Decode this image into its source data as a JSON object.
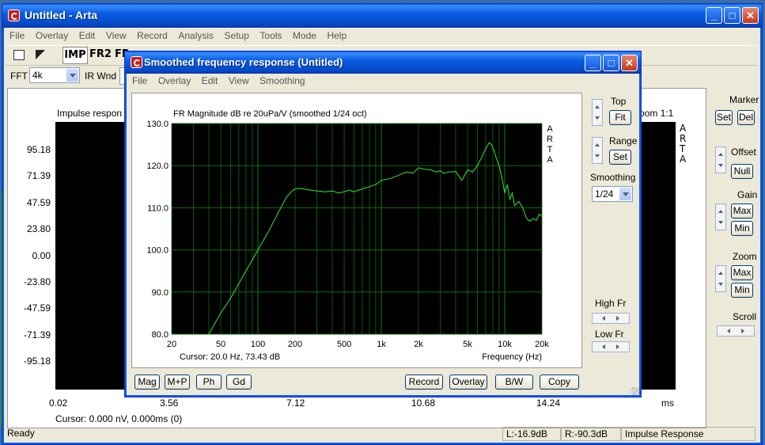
{
  "main": {
    "title": "Untitled - Arta",
    "menu": [
      "File",
      "Overlay",
      "Edit",
      "View",
      "Record",
      "Analysis",
      "Setup",
      "Tools",
      "Mode",
      "Help"
    ],
    "toolbar": {
      "imp": "IMP",
      "fr2": "FR2",
      "fr": "FR"
    },
    "fft_label": "FFT",
    "fft_value": "4k",
    "irwnd_label": "IR Wnd",
    "plot_title_left": "Impulse respon",
    "plot_title_right": "oom 1:1",
    "y_ticks": [
      "95.18",
      "71.39",
      "47.59",
      "23.80",
      "0.00",
      "-23.80",
      "-47.59",
      "-71.39",
      "-95.18"
    ],
    "x_ticks": [
      "0.02",
      "3.56",
      "7.12",
      "10.68",
      "14.24"
    ],
    "x_unit": "ms",
    "cursor": "Cursor: 0.000 nV, 0.000ms (0)",
    "arta_letters": [
      "A",
      "R",
      "T",
      "A"
    ],
    "right_panel": {
      "marker": "Marker",
      "set": "Set",
      "del": "Del",
      "offset": "Offset",
      "null": "Null",
      "gain": "Gain",
      "max": "Max",
      "min": "Min",
      "zoom": "Zoom",
      "zmax": "Max",
      "zmin": "Min",
      "scroll": "Scroll"
    },
    "status": {
      "ready": "Ready",
      "left": "L:-16.9dB",
      "right": "R:-90.3dB",
      "mode": "Impulse Response"
    }
  },
  "fr": {
    "title": "Smoothed frequency response (Untitled)",
    "menu": [
      "File",
      "Overlay",
      "Edit",
      "View",
      "Smoothing"
    ],
    "top_label": "Top",
    "fit": "Fit",
    "range_label": "Range",
    "set": "Set",
    "smoothing_label": "Smoothing",
    "smoothing_value": "1/24",
    "highfr": "High Fr",
    "lowfr": "Low Fr",
    "buttons_left": [
      "Mag",
      "M+P",
      "Ph",
      "Gd"
    ],
    "buttons_right": [
      "Record",
      "Overlay",
      "B/W",
      "Copy"
    ]
  },
  "chart_data": {
    "type": "line",
    "title": "FR Magnitude dB re 20uPa/V (smoothed 1/24 oct)",
    "xlabel": "Frequency (Hz)",
    "ylabel": "",
    "x_scale": "log",
    "xlim": [
      20,
      20000
    ],
    "ylim": [
      80,
      130
    ],
    "x_tick_labels": [
      "20",
      "50",
      "100",
      "200",
      "500",
      "1k",
      "2k",
      "5k",
      "10k",
      "20k"
    ],
    "x_tick_values": [
      20,
      50,
      100,
      200,
      500,
      1000,
      2000,
      5000,
      10000,
      20000
    ],
    "y_tick_labels": [
      "130.0",
      "120.0",
      "110.0",
      "100.0",
      "90.0",
      "80.0"
    ],
    "y_tick_values": [
      130,
      120,
      110,
      100,
      90,
      80
    ],
    "grid": true,
    "colors": {
      "background": "#000000",
      "grid": "#0e6b0e",
      "line": "#33e633"
    },
    "cursor": "Cursor: 20.0 Hz, 73.43 dB",
    "side_letters": [
      "A",
      "R",
      "T",
      "A"
    ],
    "series": [
      {
        "x": [
          40,
          50,
          60,
          70,
          80,
          100,
          120,
          150,
          170,
          190,
          200,
          220,
          250,
          300,
          350,
          400,
          450,
          500,
          550,
          600,
          700,
          800,
          900,
          1000,
          1200,
          1400,
          1600,
          1800,
          2000,
          2200,
          2500,
          2800,
          3000,
          3200,
          3500,
          4000,
          4500,
          5000,
          5500,
          6000,
          6500,
          7000,
          7500,
          7800,
          8200,
          8600,
          9000,
          9500,
          10000,
          10500,
          11000,
          11500,
          12000,
          13000,
          14000,
          15000,
          16000,
          17000,
          18000,
          19000,
          20000
        ],
        "y": [
          80,
          85,
          88.5,
          92,
          95,
          100,
          104,
          109.5,
          112.5,
          114,
          114.5,
          114.6,
          114.3,
          114,
          113.8,
          114,
          113.5,
          113.8,
          114.2,
          113.8,
          114.5,
          115,
          115.5,
          116.5,
          117,
          117.8,
          118.5,
          118.2,
          119.5,
          119.2,
          119,
          118.5,
          118.8,
          118.2,
          118.5,
          118.6,
          116.5,
          119,
          118.5,
          120,
          122,
          124,
          125.5,
          125,
          123.5,
          121.5,
          120,
          117,
          113.5,
          115.5,
          112,
          113.5,
          110.5,
          111.5,
          110,
          107.5,
          106.8,
          107.5,
          107,
          108.5,
          108
        ]
      }
    ]
  }
}
